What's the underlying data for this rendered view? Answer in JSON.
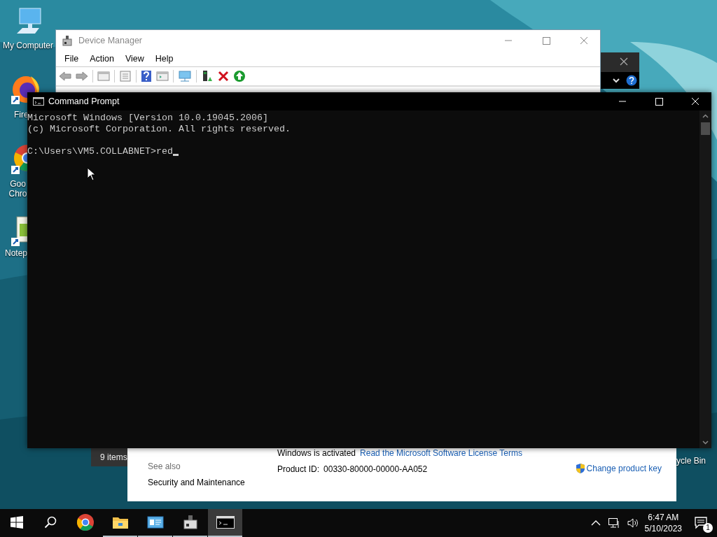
{
  "desktop_icons": [
    {
      "kind": "computer",
      "label": "My Computer"
    },
    {
      "kind": "firefox",
      "label": "Fire"
    },
    {
      "kind": "chrome",
      "label": "Goo\nChro"
    },
    {
      "kind": "notepad",
      "label": "Notep"
    }
  ],
  "device_manager": {
    "title": "Device Manager",
    "menu": [
      "File",
      "Action",
      "View",
      "Help"
    ]
  },
  "command_prompt": {
    "title": "Command Prompt",
    "lines": [
      "Microsoft Windows [Version 10.0.19045.2006]",
      "(c) Microsoft Corporation. All rights reserved."
    ],
    "prompt": "C:\\Users\\VM5.COLLABNET>red"
  },
  "explorer_status": "9 items",
  "system_panel": {
    "activation_status": "Windows is activated",
    "license_link": "Read the Microsoft Software License Terms",
    "see_also_heading": "See also",
    "see_also_links": [
      "Security and Maintenance"
    ],
    "product_id_label": "Product ID:",
    "product_id": "00330-80000-00000-AA052",
    "change_key_link": "Change product key"
  },
  "recycle_bin_label": "ycle Bin",
  "taskbar": {
    "apps": [
      {
        "kind": "chrome",
        "running": false,
        "selected": false
      },
      {
        "kind": "explorer",
        "running": true,
        "selected": false
      },
      {
        "kind": "control-panel",
        "running": true,
        "selected": false
      },
      {
        "kind": "device-manager",
        "running": true,
        "selected": false
      },
      {
        "kind": "terminal",
        "running": true,
        "selected": true
      }
    ],
    "time": "6:47 AM",
    "date": "5/10/2023",
    "notification_count": "1"
  }
}
